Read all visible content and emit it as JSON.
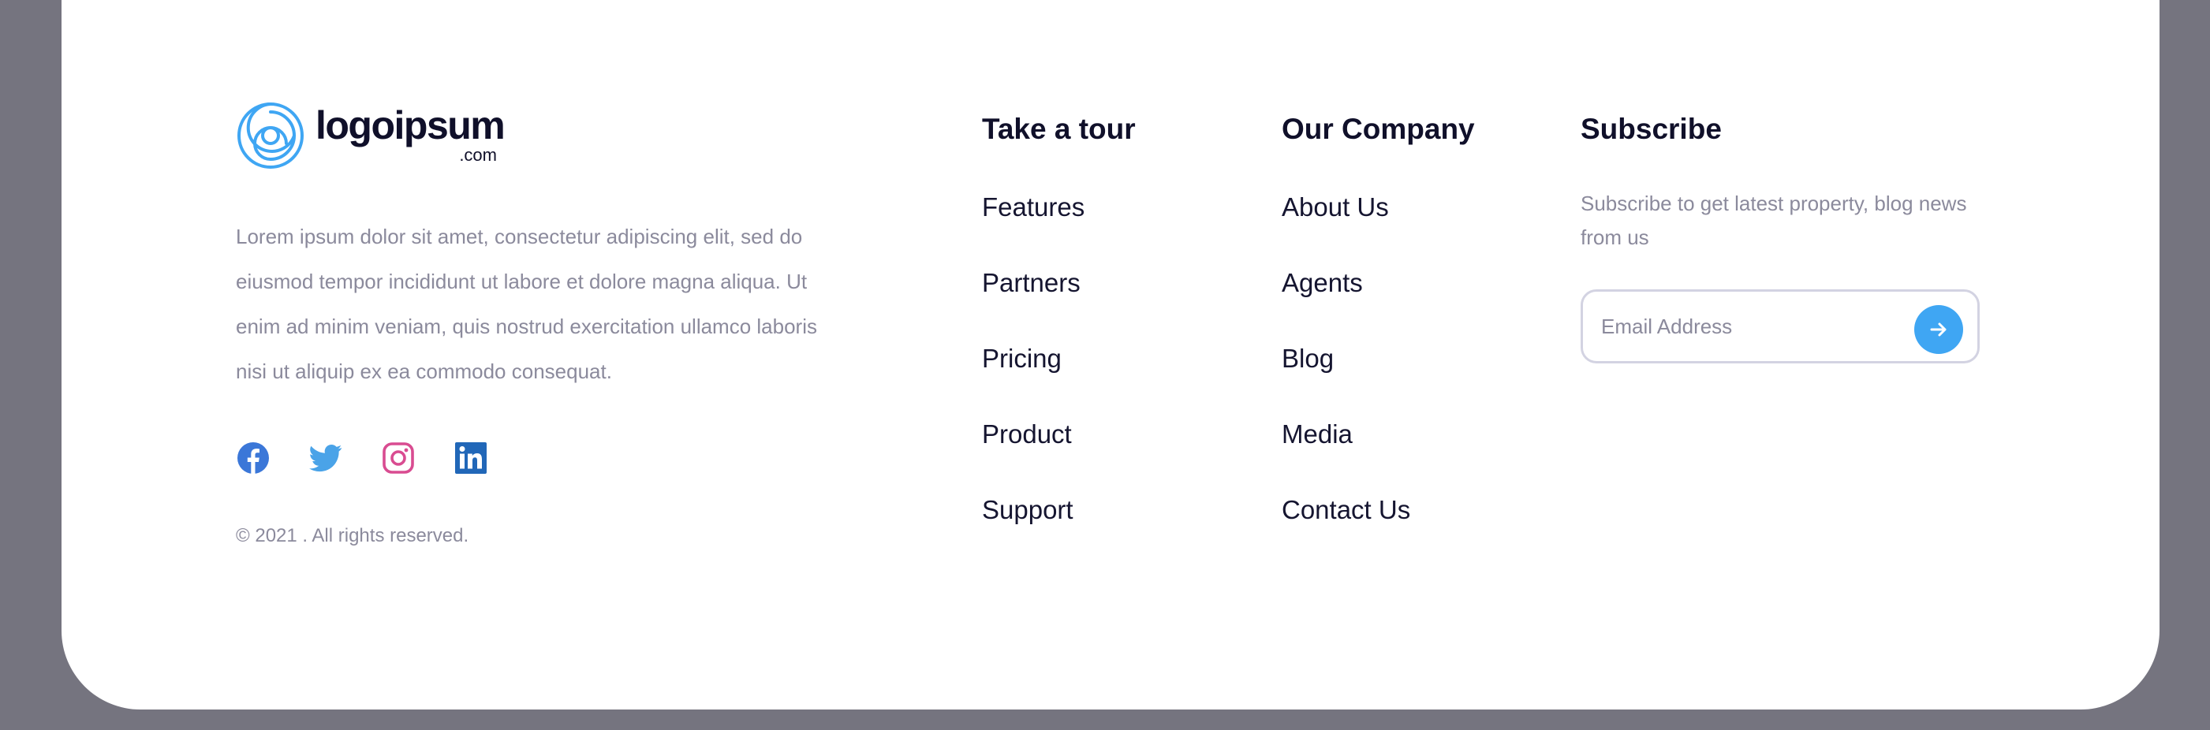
{
  "brand": {
    "name": "logoipsum",
    "tld": ".com",
    "about": "Lorem ipsum dolor sit amet, consectetur adipiscing elit, sed do eiusmod tempor incididunt ut labore et dolore magna aliqua. Ut enim ad minim veniam, quis nostrud exercitation ullamco laboris nisi ut aliquip ex ea commodo consequat.",
    "copyright": "© 2021 . All rights reserved."
  },
  "social": [
    {
      "name": "facebook-icon",
      "color": "#3b77d8"
    },
    {
      "name": "twitter-icon",
      "color": "#4aa3e8"
    },
    {
      "name": "instagram-icon",
      "color": "#d94c91"
    },
    {
      "name": "linkedin-icon",
      "color": "#2167b8"
    }
  ],
  "columns": {
    "tour": {
      "title": "Take a tour",
      "links": [
        "Features",
        "Partners",
        "Pricing",
        "Product",
        "Support"
      ]
    },
    "company": {
      "title": "Our Company",
      "links": [
        "About Us",
        "Agents",
        "Blog",
        "Media",
        "Contact Us"
      ]
    }
  },
  "subscribe": {
    "title": "Subscribe",
    "text": "Subscribe to get latest property, blog news from us",
    "placeholder": "Email Address",
    "button_icon": "arrow-right-icon"
  },
  "colors": {
    "background": "#75747f",
    "card": "#ffffff",
    "heading": "#10102a",
    "muted": "#8b8a9c",
    "accent": "#3fa6f3",
    "logo": "#3fa6f3"
  }
}
